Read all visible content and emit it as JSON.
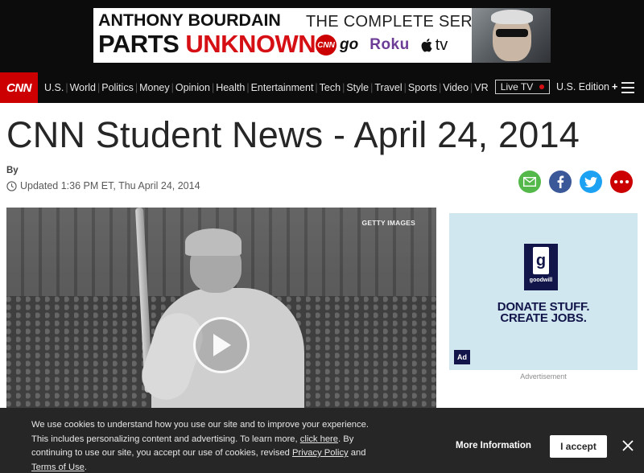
{
  "banner_ad": {
    "line1": "ANTHONY BOURDAIN",
    "line2_a": "PARTS ",
    "line2_b": "UNKNOWN",
    "tagline": "THE COMPLETE SERIES",
    "cnn_badge": "CNN",
    "go": "go",
    "roku": "Roku",
    "tv": "tv"
  },
  "nav": {
    "logo": "CNN",
    "items": [
      "U.S.",
      "World",
      "Politics",
      "Money",
      "Opinion",
      "Health",
      "Entertainment",
      "Tech",
      "Style",
      "Travel",
      "Sports",
      "Video",
      "VR"
    ],
    "live_tv": "Live TV",
    "edition": "U.S. Edition",
    "edition_plus": "+"
  },
  "article": {
    "headline": "CNN Student News - April 24, 2014",
    "byline": "By",
    "updated": "Updated 1:36 PM ET, Thu April 24, 2014"
  },
  "video": {
    "credit": "GETTY IMAGES"
  },
  "side_ad": {
    "logo_letter": "g",
    "logo_word": "goodwill",
    "line1": "DONATE STUFF.",
    "line2": "CREATE JOBS.",
    "adcouncil": "Ad",
    "label": "Advertisement"
  },
  "cookie": {
    "text_1": "We use cookies to understand how you use our site and to improve your experience. This includes personalizing content and advertising. To learn more, ",
    "link_click_here": "click here",
    "text_2": ". By continuing to use our site, you accept our use of cookies, revised ",
    "link_privacy": "Privacy Policy",
    "text_3": " and ",
    "link_terms": "Terms of Use",
    "text_4": ".",
    "more_info": "More Information",
    "accept": "I accept"
  },
  "colors": {
    "cnn_red": "#cc0000",
    "nav_bg": "#0c0c0c",
    "cookie_bg": "#262626"
  }
}
